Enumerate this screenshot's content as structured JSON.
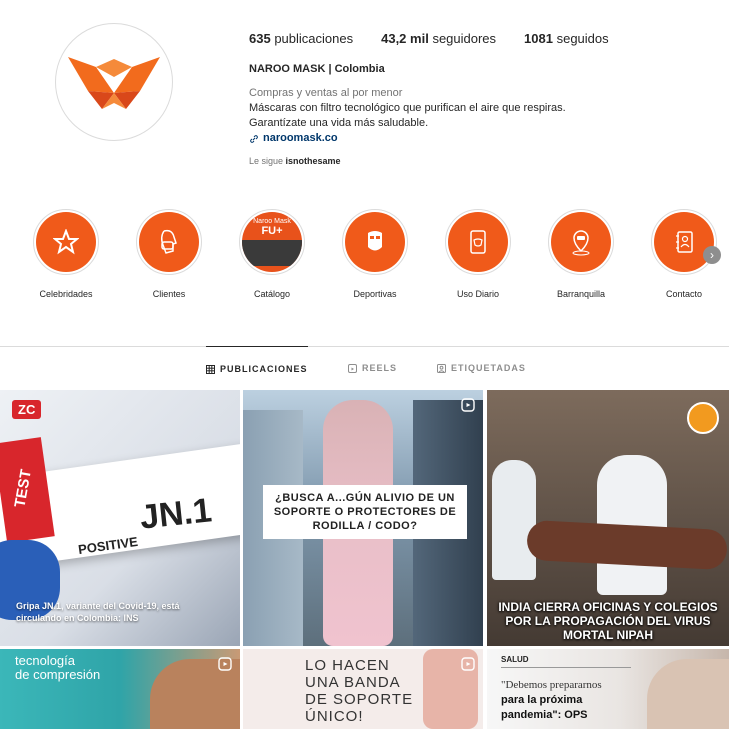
{
  "profile": {
    "stats": [
      {
        "value": "635",
        "label": "publicaciones"
      },
      {
        "value": "43,2 mil",
        "label": "seguidores"
      },
      {
        "value": "1081",
        "label": "seguidos"
      }
    ],
    "name": "NAROO MASK | Colombia",
    "category": "Compras y ventas al por menor",
    "bio_line1": "Máscaras con filtro tecnológico que purifican el aire que respiras.",
    "bio_line2": "Garantízate una vida más saludable.",
    "link": "naroomask.co",
    "followed_by_prefix": "Le sigue",
    "followed_by_user": "isnothesame",
    "brand_color": "#f05a1a"
  },
  "highlights": [
    {
      "label": "Celebridades",
      "icon": "star-icon"
    },
    {
      "label": "Clientes",
      "icon": "mask-face-icon"
    },
    {
      "label": "Catálogo",
      "icon": "catalog-photo",
      "overlay_top": "Naroo Mask",
      "overlay_main": "FU+"
    },
    {
      "label": "Deportivas",
      "icon": "sport-mask-icon"
    },
    {
      "label": "Uso Diario",
      "icon": "phone-mask-icon"
    },
    {
      "label": "Barranquilla",
      "icon": "location-pin-icon"
    },
    {
      "label": "Contacto",
      "icon": "contact-book-icon"
    }
  ],
  "tabs": [
    {
      "label": "PUBLICACIONES",
      "icon": "grid-icon",
      "active": true
    },
    {
      "label": "REELS",
      "icon": "reels-icon",
      "active": false
    },
    {
      "label": "ETIQUETADAS",
      "icon": "tagged-icon",
      "active": false
    }
  ],
  "posts": {
    "p1": {
      "badge": "ZC",
      "test": "TEST",
      "code": "JN.1",
      "positive": "POSITIVE",
      "caption": "Gripa JN.1, variante del Covid-19, está circulando en Colombia: INS"
    },
    "p2": {
      "text": "¿BUSCA A...GÚN ALIVIO DE UN SOPORTE O PROTECTORES DE RODILLA / CODO?"
    },
    "p3": {
      "text": "INDIA CIERRA OFICINAS Y COLEGIOS POR LA PROPAGACIÓN DEL VIRUS MORTAL NIPAH"
    },
    "p4": {
      "text_line1": "tecnología",
      "text_line2": "de compresión"
    },
    "p5": {
      "text": "LO HACEN UNA BANDA DE SOPORTE ÚNICO!"
    },
    "p6": {
      "tag": "SALUD",
      "quote_line1": "\"Debemos prepararnos",
      "quote_line2": "para la próxima",
      "quote_line3": "pandemia\": OPS"
    }
  }
}
